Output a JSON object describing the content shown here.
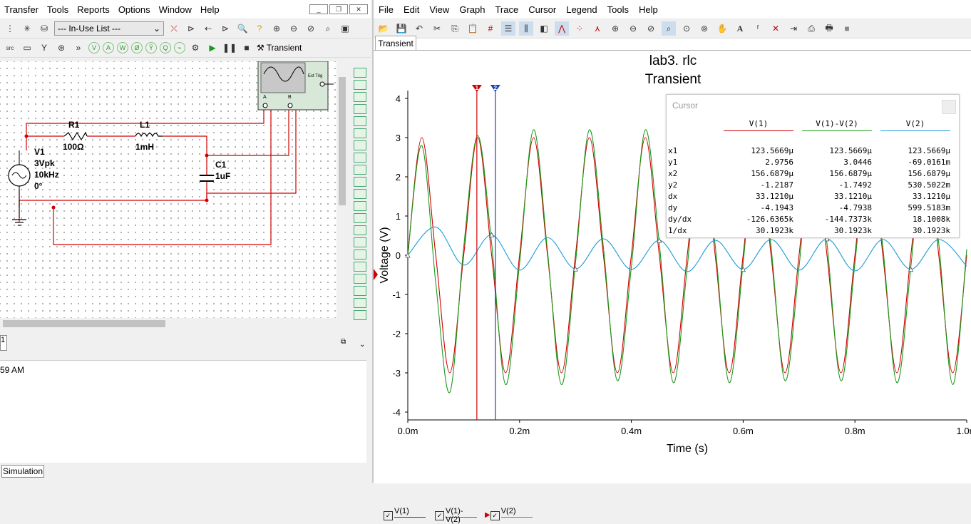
{
  "left": {
    "menu": [
      "Transfer",
      "Tools",
      "Reports",
      "Options",
      "Window",
      "Help"
    ],
    "inuse_list": "--- In-Use List ---",
    "run_mode": "Transient",
    "schematic": {
      "r1_name": "R1",
      "r1_value": "100Ω",
      "l1_name": "L1",
      "l1_value": "1mH",
      "c1_name": "C1",
      "c1_value": "1uF",
      "v1_name": "V1",
      "v1_amp": "3Vpk",
      "v1_freq": "10kHz",
      "v1_phase": "0°",
      "scope_ext": "Ext Trig",
      "scope_a": "A",
      "scope_b": "B"
    },
    "sheet_tab": "1",
    "log_text": "59 AM",
    "bottom_tab": "Simulation"
  },
  "right": {
    "menu": [
      "File",
      "Edit",
      "View",
      "Graph",
      "Trace",
      "Cursor",
      "Legend",
      "Tools",
      "Help"
    ],
    "tab": "Transient",
    "cursor_panel": {
      "title": "Cursor",
      "columns": [
        "V(1)",
        "V(1)-V(2)",
        "V(2)"
      ],
      "column_colors": [
        "#d00000",
        "#1a9a1a",
        "#1a9ad6"
      ],
      "rows": [
        {
          "label": "x1",
          "values": [
            "123.5669µ",
            "123.5669µ",
            "123.5669µ"
          ]
        },
        {
          "label": "y1",
          "values": [
            "2.9756",
            "3.0446",
            "-69.0161m"
          ]
        },
        {
          "label": "x2",
          "values": [
            "156.6879µ",
            "156.6879µ",
            "156.6879µ"
          ]
        },
        {
          "label": "y2",
          "values": [
            "-1.2187",
            "-1.7492",
            "530.5022m"
          ]
        },
        {
          "label": "dx",
          "values": [
            "33.1210µ",
            "33.1210µ",
            "33.1210µ"
          ]
        },
        {
          "label": "dy",
          "values": [
            "-4.1943",
            "-4.7938",
            "599.5183m"
          ]
        },
        {
          "label": "dy/dx",
          "values": [
            "-126.6365k",
            "-144.7373k",
            "18.1008k"
          ]
        },
        {
          "label": "1/dx",
          "values": [
            "30.1923k",
            "30.1923k",
            "30.1923k"
          ]
        }
      ]
    },
    "cursor1_label": "1",
    "cursor2_label": "2",
    "legend": [
      "V(1)",
      "V(1)-V(2)",
      "V(2)"
    ]
  },
  "chart_data": {
    "type": "line",
    "title": "lab3. rlc",
    "subtitle": "Transient",
    "xlabel": "Time (s)",
    "ylabel": "Voltage (V)",
    "xlim": [
      0,
      0.001
    ],
    "ylim": [
      -4.2,
      4.2
    ],
    "x_ticks": [
      0,
      0.0002,
      0.0004,
      0.0006,
      0.0008,
      0.001
    ],
    "x_tick_labels": [
      "0.0m",
      "0.2m",
      "0.4m",
      "0.6m",
      "0.8m",
      "1.0m"
    ],
    "y_ticks": [
      4,
      3,
      2,
      1,
      0,
      -1,
      -2,
      -3,
      -4
    ],
    "y_tick_labels": [
      "4",
      "3",
      "2",
      "1",
      "0",
      "-1",
      "-2",
      "-3",
      "-4"
    ],
    "cursors_x": [
      0.0001235669,
      0.0001566879
    ],
    "series": [
      {
        "name": "V(1)",
        "color": "#d00000",
        "x": [
          0,
          2.5e-05,
          5e-05,
          7.5e-05,
          0.0001,
          0.000125,
          0.00015,
          0.000175,
          0.0002,
          0.000225,
          0.00025,
          0.000275,
          0.0003,
          0.000325,
          0.00035,
          0.000375,
          0.0004,
          0.000425,
          0.00045,
          0.000475,
          0.0005,
          0.000525,
          0.00055,
          0.000575,
          0.0006,
          0.000625,
          0.00065,
          0.000675,
          0.0007,
          0.000725,
          0.00075,
          0.000775,
          0.0008,
          0.000825,
          0.00085,
          0.000875,
          0.0009,
          0.000925,
          0.00095,
          0.000975,
          0.001
        ],
        "y": [
          0,
          3,
          0,
          -3,
          0,
          3,
          0,
          -3,
          0,
          3,
          0,
          -3,
          0,
          3,
          0,
          -3,
          0,
          3,
          0,
          -3,
          0,
          3,
          0,
          -3,
          0,
          3,
          0,
          -3,
          0,
          3,
          0,
          -3,
          0,
          3,
          0,
          -3,
          0,
          3,
          0,
          -3,
          0
        ]
      },
      {
        "name": "V(1)-V(2)",
        "color": "#1a9a1a",
        "x": [
          0,
          2.5e-05,
          5e-05,
          7.5e-05,
          0.0001,
          0.000125,
          0.00015,
          0.000175,
          0.0002,
          0.000225,
          0.00025,
          0.000275,
          0.0003,
          0.000325,
          0.00035,
          0.000375,
          0.0004,
          0.000425,
          0.00045,
          0.000475,
          0.0005,
          0.000525,
          0.00055,
          0.000575,
          0.0006,
          0.000625,
          0.00065,
          0.000675,
          0.0007,
          0.000725,
          0.00075,
          0.000775,
          0.0008,
          0.000825,
          0.00085,
          0.000875,
          0.0009,
          0.000925,
          0.00095,
          0.000975,
          0.001
        ],
        "y": [
          0,
          2.8,
          -0.7,
          -3.5,
          0.2,
          3.05,
          0.3,
          -3.3,
          -0.2,
          3.2,
          0.1,
          -3.3,
          -0.2,
          3.2,
          0.2,
          -3.2,
          -0.3,
          3.2,
          0.3,
          -3.25,
          -0.3,
          3.15,
          0.25,
          -3.25,
          -0.2,
          3.2,
          0.2,
          -3.2,
          -0.3,
          3.2,
          0.3,
          -3.2,
          -0.2,
          3.1,
          0.2,
          -3.25,
          -0.3,
          3.15,
          0.3,
          -3.3,
          0.15
        ]
      },
      {
        "name": "V(2)",
        "color": "#1a9ad6",
        "x": [
          0,
          5e-05,
          0.0001,
          0.00015,
          0.0002,
          0.00025,
          0.0003,
          0.00035,
          0.0004,
          0.00045,
          0.0005,
          0.00055,
          0.0006,
          0.00065,
          0.0007,
          0.00075,
          0.0008,
          0.00085,
          0.0009,
          0.00095,
          0.001
        ],
        "y": [
          0,
          0.72,
          -0.25,
          0.52,
          -0.38,
          0.45,
          -0.35,
          0.42,
          -0.36,
          0.38,
          -0.42,
          0.38,
          -0.36,
          0.4,
          -0.38,
          0.42,
          -0.4,
          0.4,
          -0.36,
          0.4,
          -0.28
        ]
      }
    ]
  }
}
